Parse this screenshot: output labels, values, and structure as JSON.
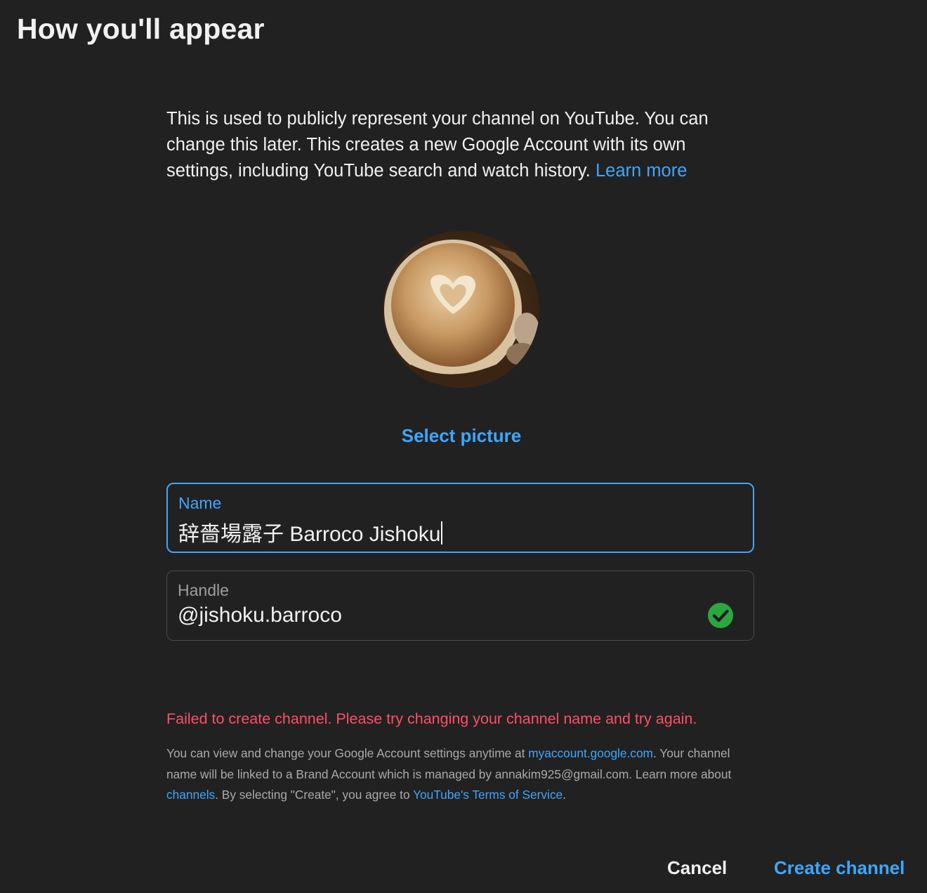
{
  "dialog": {
    "title": "How you'll appear",
    "intro_text": "This is used to publicly represent your channel on YouTube. You can change this later. This creates a new Google Account with its own settings, including YouTube search and watch history.",
    "intro_link": "Learn more"
  },
  "avatar": {
    "description": "latte-art-coffee-cup"
  },
  "select_picture_label": "Select picture",
  "name_field": {
    "label": "Name",
    "value": "辞嗇場露子 Barroco Jishoku"
  },
  "handle_field": {
    "label": "Handle",
    "value": "@jishoku.barroco",
    "status_icon": "check-circle-icon"
  },
  "error_message": "Failed to create channel. Please try changing your channel name and try again.",
  "fineprint": {
    "part1": "You can view and change your Google Account settings anytime at ",
    "link1": "myaccount.google.com",
    "part2": ". Your channel name will be linked to a Brand Account which is managed by annakim925@gmail.com. Learn more about ",
    "link2": "channels",
    "part3": ". By selecting \"Create\", you agree to ",
    "link3": "YouTube's Terms of Service",
    "part4": "."
  },
  "buttons": {
    "cancel": "Cancel",
    "create": "Create channel"
  },
  "colors": {
    "background": "#212121",
    "accent": "#3ea6ff",
    "error": "#ff4e6a",
    "success": "#2ba640"
  }
}
